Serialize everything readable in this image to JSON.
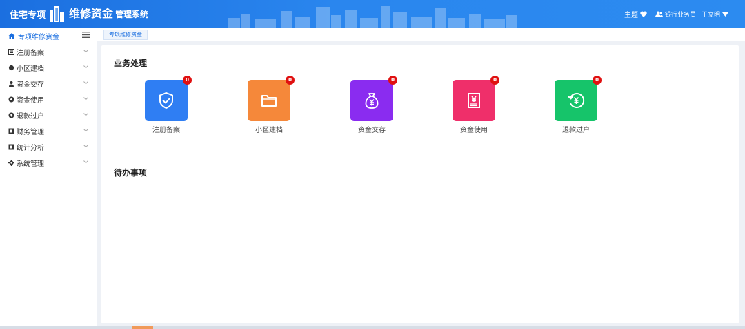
{
  "header": {
    "logo_prefix": "住宅专项",
    "logo_main": "维修资金",
    "logo_sub": "管理系统",
    "theme_label": "主题",
    "role_label": "银行业务员",
    "username": "于立明"
  },
  "sidebar": {
    "home_label": "专项维修资金",
    "items": [
      {
        "label": "注册备案",
        "icon": "register-icon"
      },
      {
        "label": "小区建档",
        "icon": "community-icon"
      },
      {
        "label": "资金交存",
        "icon": "deposit-icon"
      },
      {
        "label": "资金使用",
        "icon": "usage-icon"
      },
      {
        "label": "退款过户",
        "icon": "refund-icon"
      },
      {
        "label": "财务管理",
        "icon": "finance-icon"
      },
      {
        "label": "统计分析",
        "icon": "stats-icon"
      },
      {
        "label": "系统管理",
        "icon": "gear-icon"
      }
    ]
  },
  "breadcrumb": {
    "tab_label": "专项维修资金"
  },
  "main": {
    "business_title": "业务处理",
    "todo_title": "待办事项",
    "tiles": [
      {
        "label": "注册备案",
        "badge": "0",
        "color": "#2f7ef3",
        "icon": "shield-check-icon"
      },
      {
        "label": "小区建档",
        "badge": "0",
        "color": "#f5883a",
        "icon": "folder-icon"
      },
      {
        "label": "资金交存",
        "badge": "0",
        "color": "#8a2cf0",
        "icon": "money-bag-icon"
      },
      {
        "label": "资金使用",
        "badge": "0",
        "color": "#ef2f6a",
        "icon": "yuan-document-icon"
      },
      {
        "label": "退款过户",
        "badge": "0",
        "color": "#16c46a",
        "icon": "yuan-refund-icon"
      }
    ]
  },
  "colors": {
    "header_blue": "#1b6fe0",
    "badge_red": "#e01010",
    "panel_background": "#eef1f6"
  }
}
